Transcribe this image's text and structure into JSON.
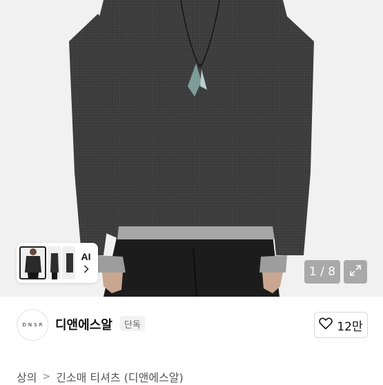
{
  "gallery": {
    "current_page": "1",
    "total_pages": "8",
    "counter_text": "1 / 8",
    "ai_label": "AI",
    "chevron_icon": "chevron-right-icon",
    "expand_icon": "expand-icon",
    "thumbnails": [
      "front view",
      "side view",
      "detail view"
    ]
  },
  "shop": {
    "logo_text": "DNSR",
    "name": "디앤에스알",
    "badge": "단독",
    "like_icon": "heart-outline-icon",
    "like_count": "12만"
  },
  "breadcrumb": {
    "items": [
      "상의",
      "긴소매 티셔츠 (디앤에스알)"
    ],
    "separator": ">"
  },
  "colors": {
    "sweater": "#3a3a3a",
    "background": "#f1f1f1",
    "overlay": "#6e6e6e"
  }
}
